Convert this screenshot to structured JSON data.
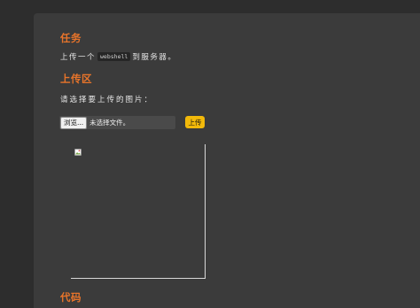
{
  "task": {
    "heading": "任务",
    "text_before": "上传一个",
    "code": "webshell",
    "text_after": "到服务器。"
  },
  "upload": {
    "heading": "上传区",
    "prompt": "请选择要上传的图片：",
    "browse_label": "浏览...",
    "file_status": "未选择文件。",
    "submit_label": "上传"
  },
  "preview": {
    "icon": "broken-image-icon"
  },
  "code_section": {
    "heading": "代码"
  },
  "colors": {
    "accent": "#e8742a",
    "button": "#f2b90a",
    "panel": "#3b3b3b",
    "background": "#2d2d2d"
  }
}
